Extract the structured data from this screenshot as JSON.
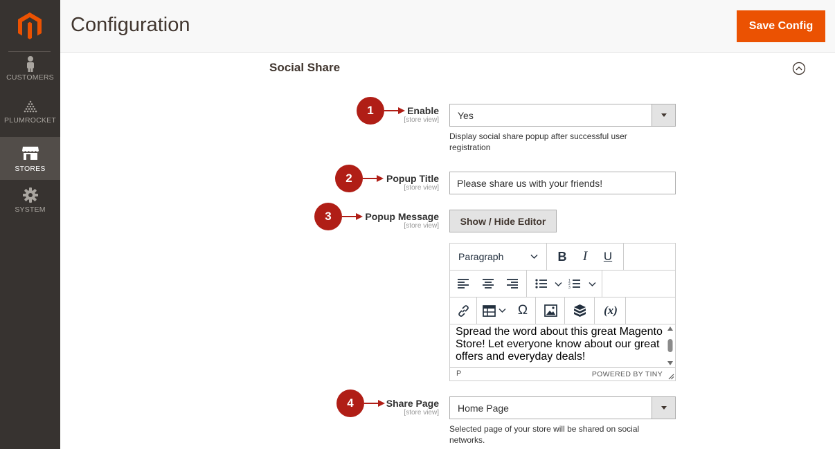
{
  "header": {
    "title": "Configuration",
    "save_label": "Save Config"
  },
  "sidebar": {
    "items": [
      {
        "label": "CUSTOMERS",
        "icon": "customer-icon",
        "active": false
      },
      {
        "label": "PLUMROCKET",
        "icon": "plumrocket-icon",
        "active": false
      },
      {
        "label": "STORES",
        "icon": "store-icon",
        "active": true
      },
      {
        "label": "SYSTEM",
        "icon": "gear-icon",
        "active": false
      }
    ]
  },
  "section": {
    "title": "Social Share"
  },
  "fields": {
    "enable": {
      "label": "Enable",
      "scope": "[store view]",
      "value": "Yes",
      "note": "Display social share popup after successful user registration",
      "callout": "1"
    },
    "popup_title": {
      "label": "Popup Title",
      "scope": "[store view]",
      "value": "Please share us with your friends!",
      "callout": "2"
    },
    "popup_message": {
      "label": "Popup Message",
      "scope": "[store view]",
      "button_label": "Show / Hide Editor",
      "callout": "3"
    },
    "share_page": {
      "label": "Share Page",
      "scope": "[store view]",
      "value": "Home Page",
      "note": "Selected page of your store will be shared on social networks.",
      "callout": "4"
    }
  },
  "editor": {
    "format": "Paragraph",
    "content": "Spread the word about this great Magento Store! Let everyone know about our great offers and everyday deals!",
    "status_path": "P",
    "powered_by": "POWERED BY TINY",
    "toolbar_glyphs": {
      "bold": "B",
      "italic": "I",
      "underline": "U",
      "omega": "Ω",
      "variable": "(x)"
    }
  },
  "colors": {
    "accent": "#eb5202",
    "sidebar_bg": "#373330",
    "callout": "#b01e16"
  }
}
